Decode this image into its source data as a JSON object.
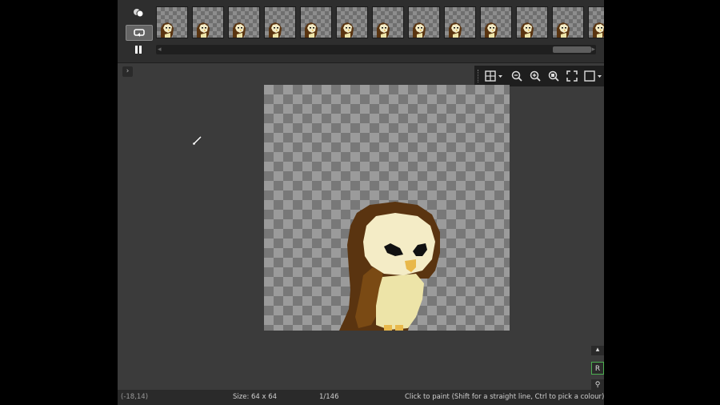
{
  "timeline": {
    "buttons": [
      {
        "name": "onion-skin-icon"
      },
      {
        "name": "loop-icon"
      },
      {
        "name": "pause-icon"
      }
    ],
    "frame_count_visible": 13
  },
  "canvas_toolbar": {
    "icons": [
      "grid-icon",
      "zoom-out-icon",
      "zoom-in-icon",
      "zoom-fit-icon",
      "fullscreen-icon",
      "background-icon"
    ]
  },
  "status": {
    "coords": "(-18,14)",
    "size": "Size: 64 x 64",
    "frame": "1/146",
    "hint": "Click to paint (Shift for a straight line, Ctrl to pick a colour)"
  },
  "side_panel": {
    "letter": "R"
  },
  "colors": {
    "owl_dark_brown": "#5a3410",
    "owl_brown": "#7a4a14",
    "owl_face": "#f4ecc6",
    "owl_belly": "#ede4a8",
    "owl_beak": "#e8b84a",
    "active_accent": "#4caf50"
  }
}
